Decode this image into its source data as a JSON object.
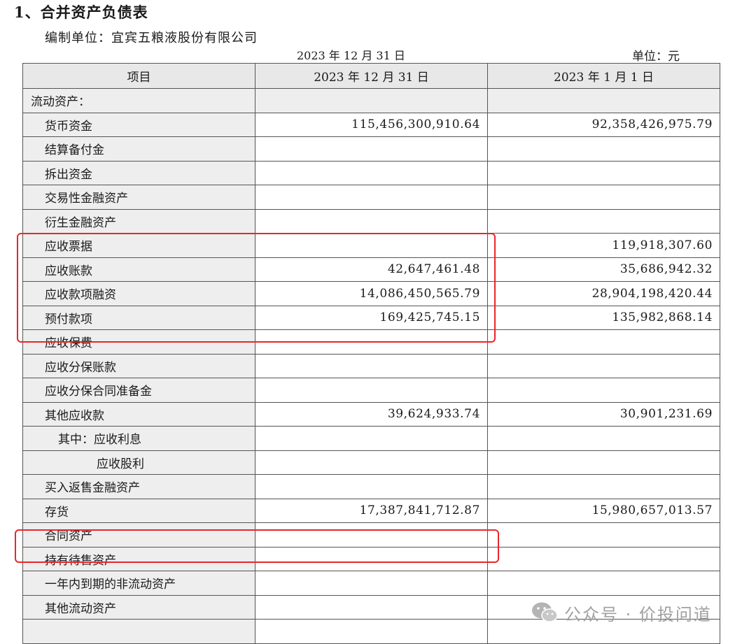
{
  "section_title": "1、合并资产负债表",
  "preparer": "编制单位：宜宾五粮液股份有限公司",
  "report_date": "2023 年 12 月 31 日",
  "currency_unit": "单位：元",
  "table": {
    "headers": [
      "项目",
      "2023 年 12 月 31 日",
      "2023 年 1 月 1 日"
    ],
    "rows": [
      {
        "label": "流动资产：",
        "v1": "",
        "v2": ""
      },
      {
        "label": "货币资金",
        "v1": "115,456,300,910.64",
        "v2": "92,358,426,975.79"
      },
      {
        "label": "结算备付金",
        "v1": "",
        "v2": ""
      },
      {
        "label": "拆出资金",
        "v1": "",
        "v2": ""
      },
      {
        "label": "交易性金融资产",
        "v1": "",
        "v2": ""
      },
      {
        "label": "衍生金融资产",
        "v1": "",
        "v2": ""
      },
      {
        "label": "应收票据",
        "v1": "",
        "v2": "119,918,307.60"
      },
      {
        "label": "应收账款",
        "v1": "42,647,461.48",
        "v2": "35,686,942.32"
      },
      {
        "label": "应收款项融资",
        "v1": "14,086,450,565.79",
        "v2": "28,904,198,420.44"
      },
      {
        "label": "预付款项",
        "v1": "169,425,745.15",
        "v2": "135,982,868.14"
      },
      {
        "label": "应收保费",
        "v1": "",
        "v2": ""
      },
      {
        "label": "应收分保账款",
        "v1": "",
        "v2": ""
      },
      {
        "label": "应收分保合同准备金",
        "v1": "",
        "v2": ""
      },
      {
        "label": "其他应收款",
        "v1": "39,624,933.74",
        "v2": "30,901,231.69"
      },
      {
        "label": "其中：应收利息",
        "v1": "",
        "v2": ""
      },
      {
        "label": "应收股利",
        "v1": "",
        "v2": ""
      },
      {
        "label": "买入返售金融资产",
        "v1": "",
        "v2": ""
      },
      {
        "label": "存货",
        "v1": "17,387,841,712.87",
        "v2": "15,980,657,013.57"
      },
      {
        "label": "合同资产",
        "v1": "",
        "v2": ""
      },
      {
        "label": "持有待售资产",
        "v1": "",
        "v2": ""
      },
      {
        "label": "一年内到期的非流动资产",
        "v1": "",
        "v2": ""
      },
      {
        "label": "其他流动资产",
        "v1": "",
        "v2": ""
      },
      {
        "label": "",
        "v1": "",
        "v2": ""
      }
    ]
  },
  "watermark": {
    "text": "公众号 · 价投问道",
    "icon": "wechat-icon"
  },
  "colors": {
    "highlight": "#e8262b",
    "label_bg": "#eeeeee",
    "header_bg": "#e8e8e8"
  }
}
